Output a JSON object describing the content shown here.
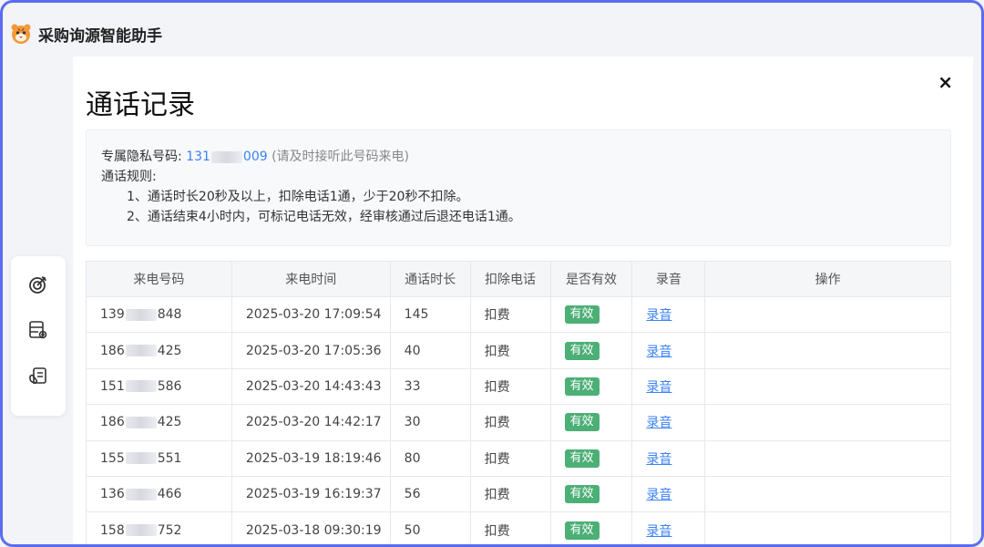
{
  "app": {
    "title": "采购询源智能助手"
  },
  "modal": {
    "title": "通话记录",
    "close_label": "×",
    "info": {
      "private_label": "专属隐私号码:",
      "private_prefix": "131",
      "private_suffix": "009",
      "private_hint": "(请及时接听此号码来电)",
      "rules_title": "通话规则:",
      "rules": [
        "1、通话时长20秒及以上，扣除电话1通，少于20秒不扣除。",
        "2、通话结束4小时内，可标记电话无效，经审核通过后退还电话1通。"
      ]
    },
    "table": {
      "headers": [
        "来电号码",
        "来电时间",
        "通话时长",
        "扣除电话",
        "是否有效",
        "录音",
        "操作"
      ],
      "rows": [
        {
          "phone_prefix": "139",
          "phone_suffix": "848",
          "time": "2025-03-20 17:09:54",
          "duration": "145",
          "deduct": "扣费",
          "valid": "有效",
          "recording": "录音"
        },
        {
          "phone_prefix": "186",
          "phone_suffix": "425",
          "time": "2025-03-20 17:05:36",
          "duration": "40",
          "deduct": "扣费",
          "valid": "有效",
          "recording": "录音"
        },
        {
          "phone_prefix": "151",
          "phone_suffix": "586",
          "time": "2025-03-20 14:43:43",
          "duration": "33",
          "deduct": "扣费",
          "valid": "有效",
          "recording": "录音"
        },
        {
          "phone_prefix": "186",
          "phone_suffix": "425",
          "time": "2025-03-20 14:42:17",
          "duration": "30",
          "deduct": "扣费",
          "valid": "有效",
          "recording": "录音"
        },
        {
          "phone_prefix": "155",
          "phone_suffix": "551",
          "time": "2025-03-19 18:19:46",
          "duration": "80",
          "deduct": "扣费",
          "valid": "有效",
          "recording": "录音"
        },
        {
          "phone_prefix": "136",
          "phone_suffix": "466",
          "time": "2025-03-19 16:19:37",
          "duration": "56",
          "deduct": "扣费",
          "valid": "有效",
          "recording": "录音"
        },
        {
          "phone_prefix": "158",
          "phone_suffix": "752",
          "time": "2025-03-18 09:30:19",
          "duration": "50",
          "deduct": "扣费",
          "valid": "有效",
          "recording": "录音"
        }
      ]
    }
  },
  "sidebar": {
    "icons": [
      "target-icon",
      "database-settings-icon",
      "clipboard-hand-icon"
    ]
  },
  "colors": {
    "accent": "#3b82f6",
    "valid_badge": "#4caf76",
    "frame": "#5b6cf0"
  }
}
